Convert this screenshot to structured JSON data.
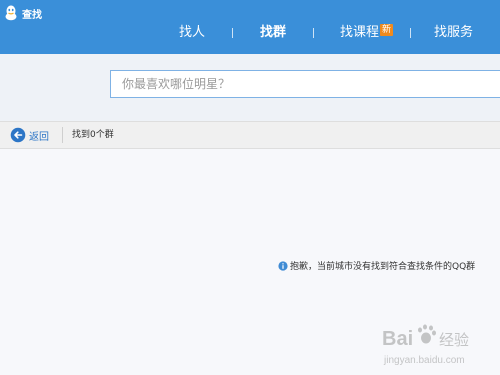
{
  "window": {
    "title": "查找"
  },
  "tabs": [
    {
      "label": "找人",
      "active": false
    },
    {
      "label": "找群",
      "active": true
    },
    {
      "label": "找课程",
      "active": false,
      "badge": "新"
    },
    {
      "label": "找服务",
      "active": false
    }
  ],
  "search": {
    "placeholder": "你最喜欢哪位明星？",
    "value": ""
  },
  "toolbar": {
    "back_label": "返回",
    "result_count": "找到0个群"
  },
  "empty_message": "抱歉，当前城市没有找到符合查找条件的QQ群",
  "colors": {
    "titlebar": "#3a8fd9",
    "accent": "#2c75c6",
    "badge": "#f08a1c",
    "input_border": "#7fb2e5"
  },
  "icons": {
    "app": "qq-penguin-icon",
    "back": "back-arrow-circle-icon",
    "info": "info-icon"
  },
  "watermark": {
    "brand": "Baidu 经验",
    "url": "jingyan.baidu.com"
  }
}
